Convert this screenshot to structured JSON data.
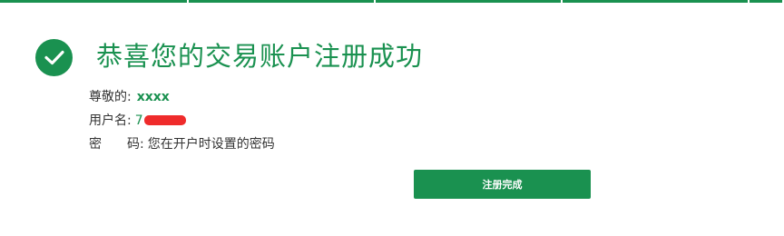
{
  "title": "恭喜您的交易账户注册成功",
  "greeting": {
    "label": "尊敬的:",
    "name": "xxxx"
  },
  "username": {
    "label": "用户名:",
    "value_visible": "7"
  },
  "password": {
    "label_1": "密",
    "label_2": "码:",
    "hint": "您在开户时设置的密码"
  },
  "finish_button": "注册完成",
  "colors": {
    "brand_green": "#1a9150",
    "redaction_red": "#ef2b2b",
    "text": "#333333"
  },
  "icons": {
    "success": "check-circle-icon"
  }
}
